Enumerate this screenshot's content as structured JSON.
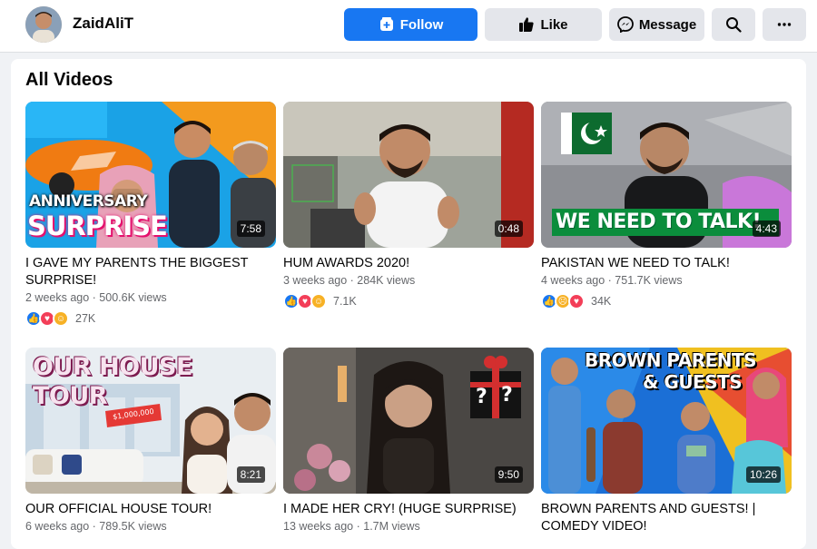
{
  "header": {
    "page_name": "ZaidAliT",
    "follow_label": "Follow",
    "like_label": "Like",
    "message_label": "Message",
    "icons": {
      "follow": "follow-plus-icon",
      "like": "thumbs-up-icon",
      "message": "messenger-icon",
      "search": "search-icon",
      "more": "more-horizontal-icon"
    }
  },
  "section": {
    "title": "All Videos"
  },
  "colors": {
    "accent": "#1877f2",
    "like": "#1877f2",
    "love": "#f33e58",
    "haha": "#f7b125"
  },
  "videos": [
    {
      "title": "I GAVE MY PARENTS THE BIGGEST SURPRISE!",
      "meta": "2 weeks ago · 500.6K views",
      "duration": "7:58",
      "reactions": [
        "like",
        "love",
        "care"
      ],
      "reaction_count": "27K",
      "thumb_text": [
        "ANNIVERSARY",
        "SURPRISE"
      ]
    },
    {
      "title": "HUM AWARDS 2020!",
      "meta": "3 weeks ago · 284K views",
      "duration": "0:48",
      "reactions": [
        "like",
        "love",
        "haha"
      ],
      "reaction_count": "7.1K",
      "thumb_text": []
    },
    {
      "title": "PAKISTAN WE NEED TO TALK!",
      "meta": "4 weeks ago · 751.7K views",
      "duration": "4:43",
      "reactions": [
        "like",
        "sad",
        "love"
      ],
      "reaction_count": "34K",
      "thumb_text": [
        "WE NEED TO TALK!"
      ]
    },
    {
      "title": "OUR OFFICIAL HOUSE TOUR!",
      "meta": "6 weeks ago · 789.5K views",
      "duration": "8:21",
      "reactions": [],
      "reaction_count": "",
      "thumb_text": [
        "OUR HOUSE",
        "TOUR",
        "$1,000,000"
      ]
    },
    {
      "title": "I MADE HER CRY! (HUGE SURPRISE)",
      "meta": "13 weeks ago · 1.7M views",
      "duration": "9:50",
      "reactions": [],
      "reaction_count": "",
      "thumb_text": [
        "?",
        "?"
      ]
    },
    {
      "title": "BROWN PARENTS AND GUESTS! | COMEDY VIDEO!",
      "meta": "",
      "duration": "10:26",
      "reactions": [],
      "reaction_count": "",
      "thumb_text": [
        "BROWN PARENTS",
        "& GUESTS"
      ]
    }
  ]
}
